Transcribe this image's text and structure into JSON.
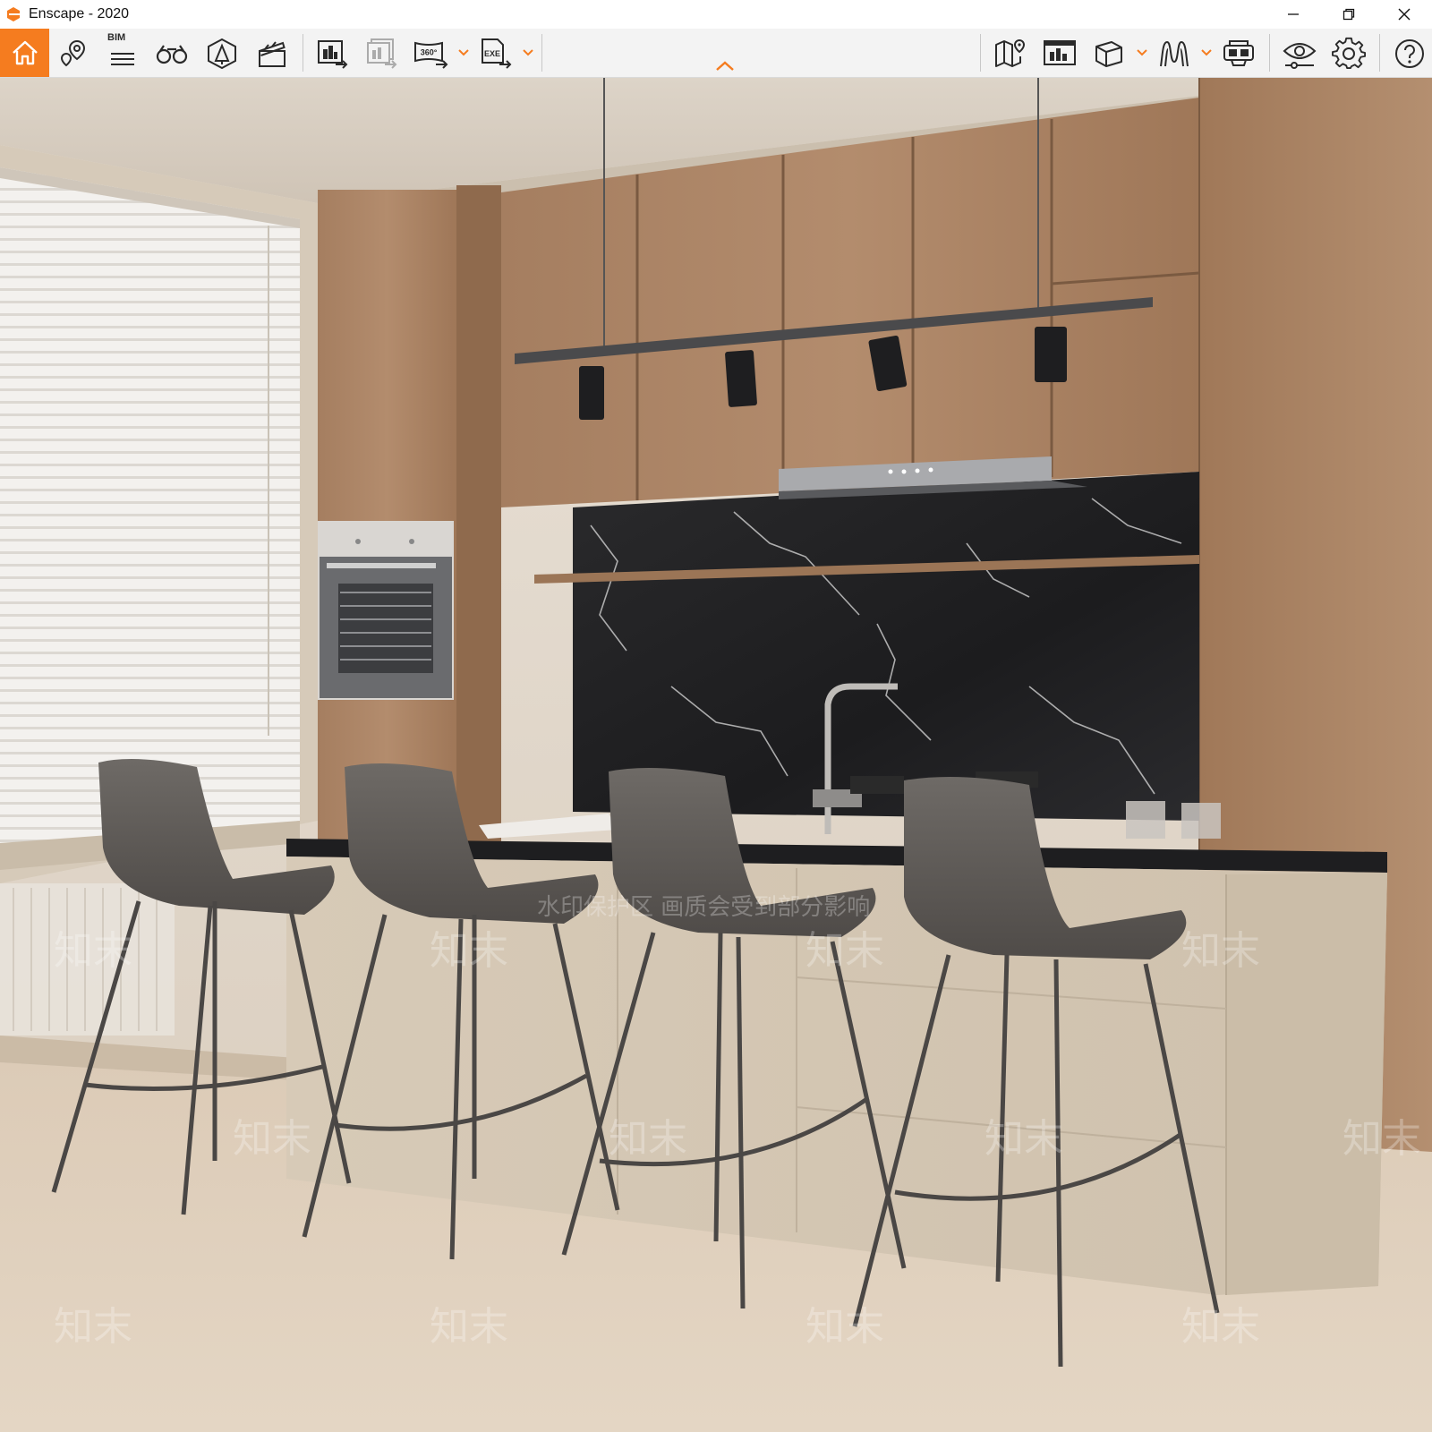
{
  "window": {
    "title": "Enscape - 2020",
    "controls": [
      "minimize",
      "restore",
      "close"
    ]
  },
  "toolbar": {
    "accent_color": "#f57c1f",
    "bim_label": "BIM",
    "pano_label": "360°",
    "exe_label": "EXE",
    "left_tools": [
      "home-icon",
      "views-icon",
      "bim-icon",
      "binoculars-icon",
      "asset-library-icon",
      "video-editor-icon",
      "screenshot-export-icon",
      "batch-render-icon",
      "panorama-export-icon",
      "exe-export-icon"
    ],
    "right_tools": [
      "map-icon",
      "render-view-icon",
      "cube-icon",
      "atmosphere-icon",
      "vr-headset-icon",
      "visual-settings-icon",
      "settings-icon",
      "help-icon"
    ]
  },
  "watermark": {
    "notice": "水印保护区  画质会受到部分影响",
    "brand": "知末"
  }
}
